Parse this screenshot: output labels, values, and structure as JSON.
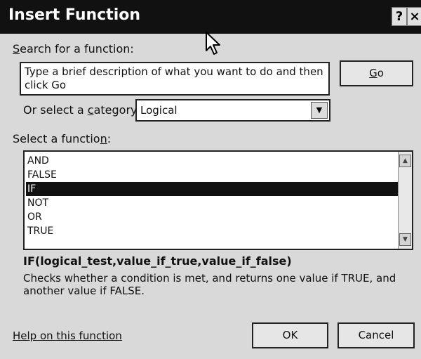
{
  "dialog": {
    "title": "Insert Function",
    "help_button": "?",
    "close_button": "×"
  },
  "search": {
    "label_prefix": "",
    "label_mnemonic": "S",
    "label_rest": "earch for a function:",
    "value": "Type a brief description of what you want to do and then click Go",
    "go_prefix": "",
    "go_mnemonic": "G",
    "go_rest": "o"
  },
  "category": {
    "label_prefix": "Or select a ",
    "label_mnemonic": "c",
    "label_rest": "ategory:",
    "value": "Logical",
    "arrow": "▼"
  },
  "function_list": {
    "label_prefix": "Select a functio",
    "label_mnemonic": "n",
    "label_rest": ":",
    "items": [
      "AND",
      "FALSE",
      "IF",
      "NOT",
      "OR",
      "TRUE"
    ],
    "selected": "IF",
    "scroll_up": "▲",
    "scroll_down": "▼"
  },
  "details": {
    "signature": "IF(logical_test,value_if_true,value_if_false)",
    "description": "Checks whether a condition is met, and returns one value if TRUE, and another value if FALSE."
  },
  "footer": {
    "help_link": "Help on this function",
    "ok_label": "OK",
    "cancel_label": "Cancel"
  },
  "colors": {
    "title_bar": "#111111",
    "selection": "#111111",
    "dialog_background": "#d9d9d9"
  }
}
